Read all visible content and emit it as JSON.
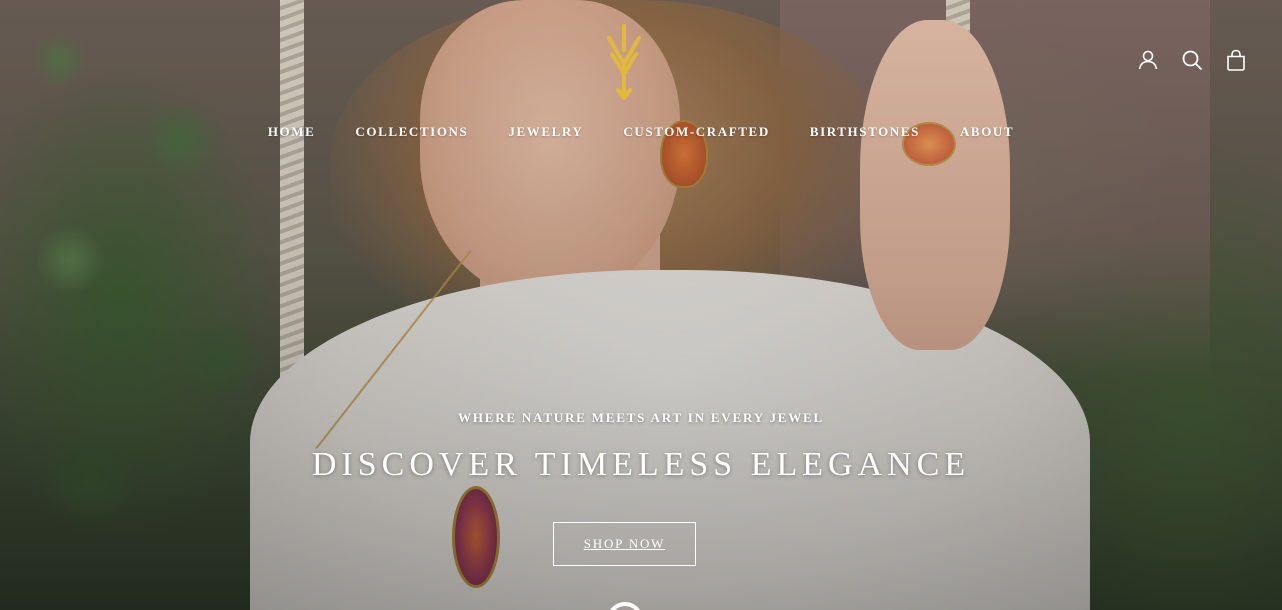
{
  "brand": {
    "logo_icon": "brand-monogram-logo",
    "logo_color": "#e2b93b"
  },
  "header": {
    "icons": [
      {
        "name": "account-icon"
      },
      {
        "name": "search-icon"
      },
      {
        "name": "cart-icon"
      }
    ]
  },
  "nav": {
    "items": [
      {
        "label": "HOME"
      },
      {
        "label": "COLLECTIONS"
      },
      {
        "label": "JEWELRY"
      },
      {
        "label": "CUSTOM-CRAFTED"
      },
      {
        "label": "BIRTHSTONES"
      },
      {
        "label": "ABOUT"
      }
    ]
  },
  "hero": {
    "subheading": "WHERE NATURE MEETS ART IN EVERY JEWEL",
    "heading": "DISCOVER TIMELESS ELEGANCE",
    "cta_label": "SHOP NOW"
  },
  "colors": {
    "text": "#ffffff",
    "accent": "#e2b93b"
  }
}
